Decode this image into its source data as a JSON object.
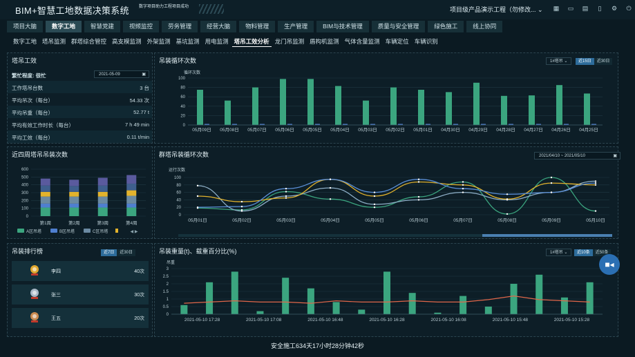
{
  "header": {
    "title": "BIM+智慧工地数据决策系统",
    "subtitle": "数字项目助力工程项目成功",
    "project": "项目级产品演示工程（勿修改...",
    "icons": [
      "grid-icon",
      "monitor-icon",
      "document-icon",
      "tablet-icon",
      "settings-icon",
      "power-icon"
    ]
  },
  "nav1": [
    "项目大脑",
    "数字工地",
    "智慧党建",
    "视频监控",
    "劳务管理",
    "经营大脑",
    "物料管理",
    "生产管理",
    "BIM与技术管理",
    "质量与安全管理",
    "绿色施工",
    "线上协同"
  ],
  "nav1_active": 1,
  "nav2": [
    "数字工地",
    "塔吊监测",
    "群塔综合管控",
    "高支模监测",
    "外架监测",
    "基坑监测",
    "用电监测",
    "塔吊工效分析",
    "龙门吊监测",
    "盾构机监测",
    "气体含量监测",
    "车辆定位",
    "车辆识别"
  ],
  "nav2_active": 7,
  "efficiency": {
    "title": "塔吊工效",
    "busy_label": "繁忙程度: 很忙",
    "date": "2021-05-09",
    "rows": [
      {
        "k": "工作塔吊台数",
        "v": "3 台"
      },
      {
        "k": "平均吊次（每台）",
        "v": "54.33 次"
      },
      {
        "k": "平均吊重（每台）",
        "v": "52.77 t"
      },
      {
        "k": "平均有效工作时长（每台）",
        "v": "7 h 49 min"
      },
      {
        "k": "平均工效（每台）",
        "v": "0.11 t/min"
      }
    ]
  },
  "cycles": {
    "title": "吊装循环次数",
    "dropdown": "1#塔吊",
    "btn_on": "近15日",
    "btn_off": "近30日"
  },
  "weekly": {
    "title": "近四周塔吊吊装次数",
    "legend": [
      "A区吊塔",
      "B区吊塔",
      "C区吊塔"
    ]
  },
  "group": {
    "title": "群塔吊装循环次数",
    "date_from": "2021/04/10",
    "date_to": "2021/05/10"
  },
  "ranking": {
    "title": "吊装排行榜",
    "btn_on": "近7日",
    "btn_off": "近30日",
    "items": [
      {
        "name": "李四",
        "count": "40次"
      },
      {
        "name": "张三",
        "count": "30次"
      },
      {
        "name": "王五",
        "count": "20次"
      }
    ]
  },
  "weight": {
    "title": "吊装重量(t)、载重百分比(%)",
    "dropdown": "1#塔吊",
    "btn_on": "近10条",
    "btn_off": "近50条"
  },
  "footer": {
    "safe": "安全施工634天17小时28分钟42秒"
  },
  "colors": {
    "green": "#3ba57f",
    "blue": "#4f7fd0",
    "yellow": "#e3b32c",
    "red": "#e2674a"
  },
  "chart_data": [
    {
      "type": "bar",
      "title": "吊装循环次数",
      "ylabel": "循环次数",
      "ylim": [
        0,
        100
      ],
      "categories": [
        "05月09日",
        "05月08日",
        "05月07日",
        "05月06日",
        "05月05日",
        "05月04日",
        "05月03日",
        "05月02日",
        "05月01日",
        "04月30日",
        "04月29日",
        "04月28日",
        "04月27日",
        "04月26日",
        "04月25日"
      ],
      "series": [
        {
          "values": [
            75,
            52,
            80,
            98,
            98,
            83,
            52,
            80,
            75,
            70,
            90,
            62,
            63,
            85,
            67
          ]
        },
        {
          "values": [
            2,
            0,
            0,
            1,
            0,
            0,
            0,
            1,
            0,
            0,
            1,
            1,
            0,
            1,
            0
          ]
        }
      ]
    },
    {
      "type": "bar",
      "title": "近四周塔吊吊装次数",
      "ylim": [
        0,
        600
      ],
      "categories": [
        "第1周",
        "第2周",
        "第3周",
        "第4周"
      ],
      "series": [
        {
          "name": "A区吊塔",
          "values": [
            110,
            110,
            110,
            110
          ]
        },
        {
          "name": "B区吊塔",
          "values": [
            50,
            50,
            50,
            50
          ]
        },
        {
          "name": "C区吊塔",
          "values": [
            90,
            90,
            90,
            100
          ]
        },
        {
          "name": "",
          "values": [
            60,
            60,
            60,
            70
          ]
        },
        {
          "name": "",
          "values": [
            80,
            75,
            80,
            85
          ]
        },
        {
          "name": "",
          "values": [
            90,
            80,
            100,
            110
          ]
        }
      ]
    },
    {
      "type": "line",
      "title": "群塔吊装循环次数",
      "ylabel": "运行次数",
      "ylim": [
        0,
        100
      ],
      "categories": [
        "05月01日",
        "05月02日",
        "05月03日",
        "05月04日",
        "05月05日",
        "05月06日",
        "05月07日",
        "05月08日",
        "05月09日",
        "05月10日"
      ],
      "series": [
        {
          "values": [
            18,
            13,
            62,
            42,
            20,
            48,
            88,
            2,
            100,
            10
          ]
        },
        {
          "values": [
            78,
            10,
            50,
            72,
            28,
            40,
            60,
            40,
            60,
            90
          ]
        },
        {
          "values": [
            50,
            35,
            45,
            95,
            50,
            88,
            80,
            42,
            85,
            80
          ]
        },
        {
          "values": [
            20,
            22,
            70,
            95,
            60,
            95,
            70,
            55,
            60,
            85
          ]
        }
      ]
    },
    {
      "type": "bar",
      "title": "吊装重量(t)、载重百分比(%)",
      "ylabel": "吊重",
      "ylim": [
        0,
        3
      ],
      "categories": [
        "2021-05-10 17:28",
        "2021-05-10 17:08",
        "2021-05-10 16:48",
        "2021-05-10 16:28",
        "2021-05-10 16:08",
        "2021-05-10 15:48",
        "2021-05-10 15:28"
      ],
      "series": [
        {
          "name": "吊重",
          "values": [
            0.6,
            2.1,
            2.8,
            0.2,
            2.4,
            1.7,
            0.8,
            0.3,
            2.8,
            1.4,
            0.1,
            1.2,
            0.5,
            2.0,
            2.6,
            1.1,
            2.1
          ]
        },
        {
          "name": "载重百分比",
          "values": [
            0.45,
            0.5,
            0.55,
            0.5,
            0.5,
            0.45,
            0.55,
            0.5,
            0.5,
            0.55,
            0.5,
            0.5,
            0.6,
            0.75,
            0.6,
            0.55,
            0.5
          ]
        }
      ]
    }
  ]
}
